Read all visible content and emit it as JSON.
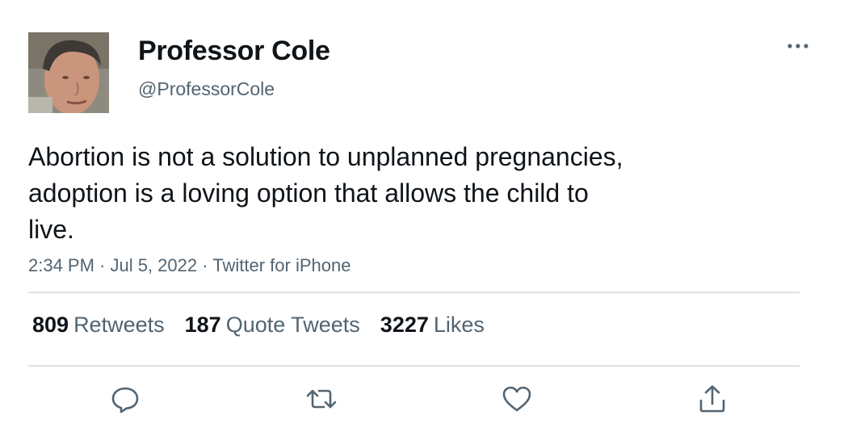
{
  "author": {
    "display_name": "Professor Cole",
    "handle": "@ProfessorCole"
  },
  "tweet": {
    "text": "Abortion is not a solution to unplanned pregnancies,\nadoption is a loving option that allows the child to\nlive.",
    "timestamp": "2:34 PM · Jul 5, 2022 · Twitter for iPhone"
  },
  "stats": {
    "retweets": {
      "count": "809",
      "label": "Retweets"
    },
    "quotes": {
      "count": "187",
      "label": "Quote Tweets"
    },
    "likes": {
      "count": "3227",
      "label": "Likes"
    }
  },
  "icons": {
    "more": "more-icon",
    "reply": "reply-icon",
    "retweet": "retweet-icon",
    "like": "like-icon",
    "share": "share-icon"
  },
  "colors": {
    "text": "#0f1419",
    "secondary": "#536471",
    "divider": "#dde2e6"
  }
}
